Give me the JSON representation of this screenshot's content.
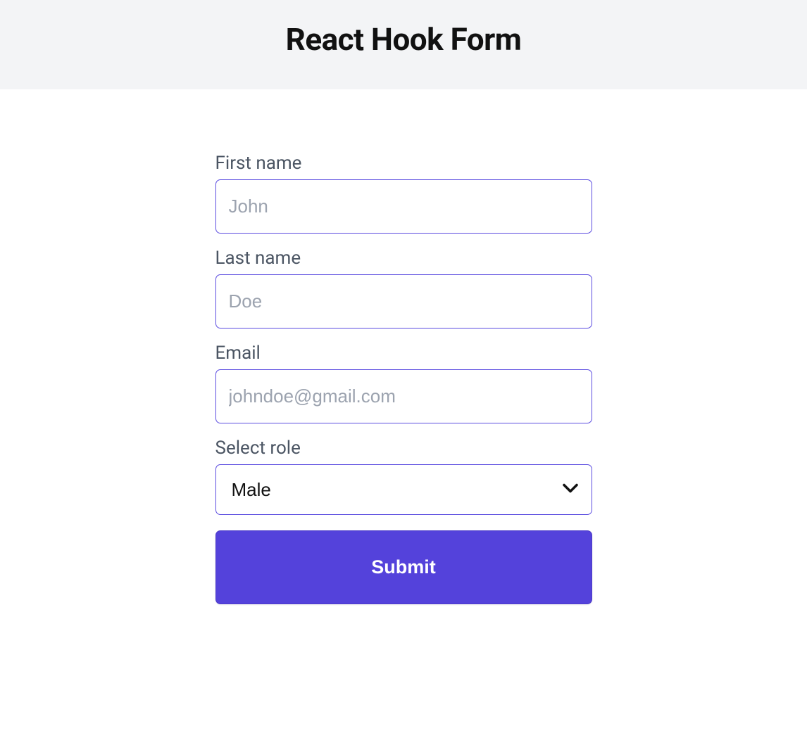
{
  "header": {
    "title": "React Hook Form"
  },
  "form": {
    "first_name": {
      "label": "First name",
      "placeholder": "John",
      "value": ""
    },
    "last_name": {
      "label": "Last name",
      "placeholder": "Doe",
      "value": ""
    },
    "email": {
      "label": "Email",
      "placeholder": "johndoe@gmail.com",
      "value": ""
    },
    "role": {
      "label": "Select role",
      "selected": "Male"
    },
    "submit_label": "Submit"
  }
}
